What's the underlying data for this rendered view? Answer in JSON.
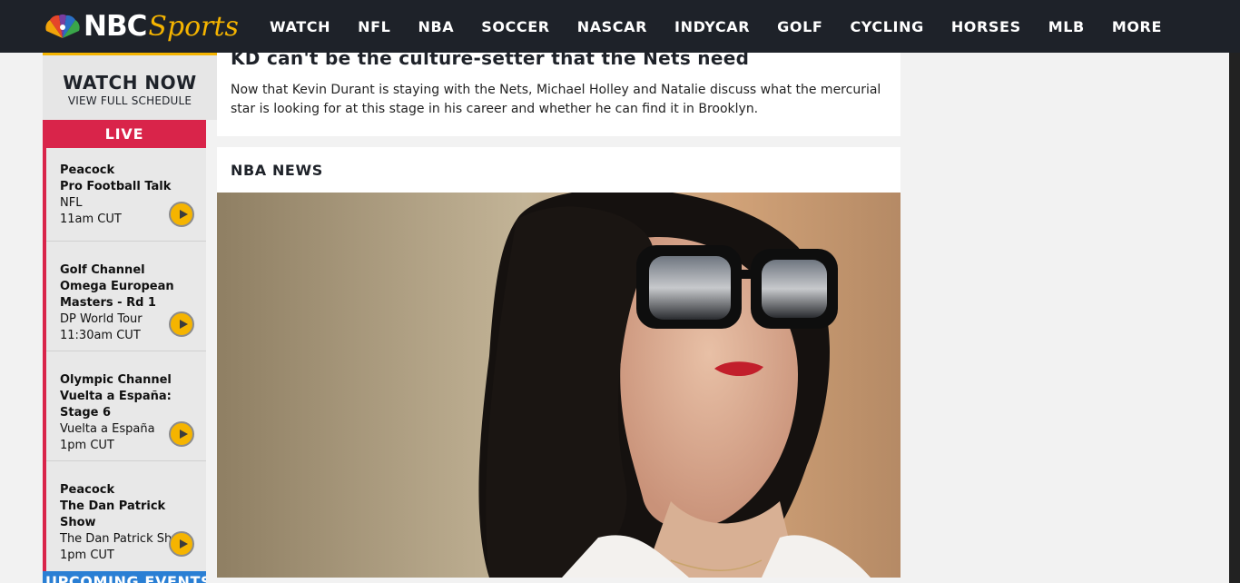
{
  "brand": {
    "nbc": "NBC",
    "sports": "Sports",
    "accent": "#f5b400",
    "nav_bg": "#1e2229"
  },
  "nav": {
    "items": [
      {
        "label": "WATCH"
      },
      {
        "label": "NFL"
      },
      {
        "label": "NBA"
      },
      {
        "label": "SOCCER"
      },
      {
        "label": "NASCAR"
      },
      {
        "label": "INDYCAR"
      },
      {
        "label": "GOLF"
      },
      {
        "label": "CYCLING"
      },
      {
        "label": "HORSES"
      },
      {
        "label": "MLB"
      },
      {
        "label": "MORE"
      }
    ]
  },
  "sidebar": {
    "watch_now": {
      "title": "WATCH NOW",
      "subtitle": "VIEW FULL SCHEDULE"
    },
    "live_label": "LIVE",
    "live_color": "#d9244a",
    "live_items": [
      {
        "network": "Peacock",
        "show": "Pro Football Talk",
        "league": "NFL",
        "time": "11am CUT"
      },
      {
        "network": "Golf Channel",
        "show": "Omega European Masters - Rd 1",
        "league": "DP World Tour",
        "time": "11:30am CUT"
      },
      {
        "network": "Olympic Channel",
        "show": "Vuelta a España: Stage 6",
        "league": "Vuelta a España",
        "time": "1pm CUT"
      },
      {
        "network": "Peacock",
        "show": "The Dan Patrick Show",
        "league": "The Dan Patrick Show",
        "time": "1pm CUT"
      }
    ],
    "upcoming_label": "UPCOMING EVENTS",
    "upcoming_color": "#2a7fd4"
  },
  "main": {
    "article": {
      "title": "KD can't be the culture-setter that the Nets need",
      "description": "Now that Kevin Durant is staying with the Nets, Michael Holley and Natalie discuss what the mercurial star is looking for at this stage in his career and whether he can find it in Brooklyn."
    },
    "news_section": {
      "title": "NBA NEWS"
    }
  }
}
